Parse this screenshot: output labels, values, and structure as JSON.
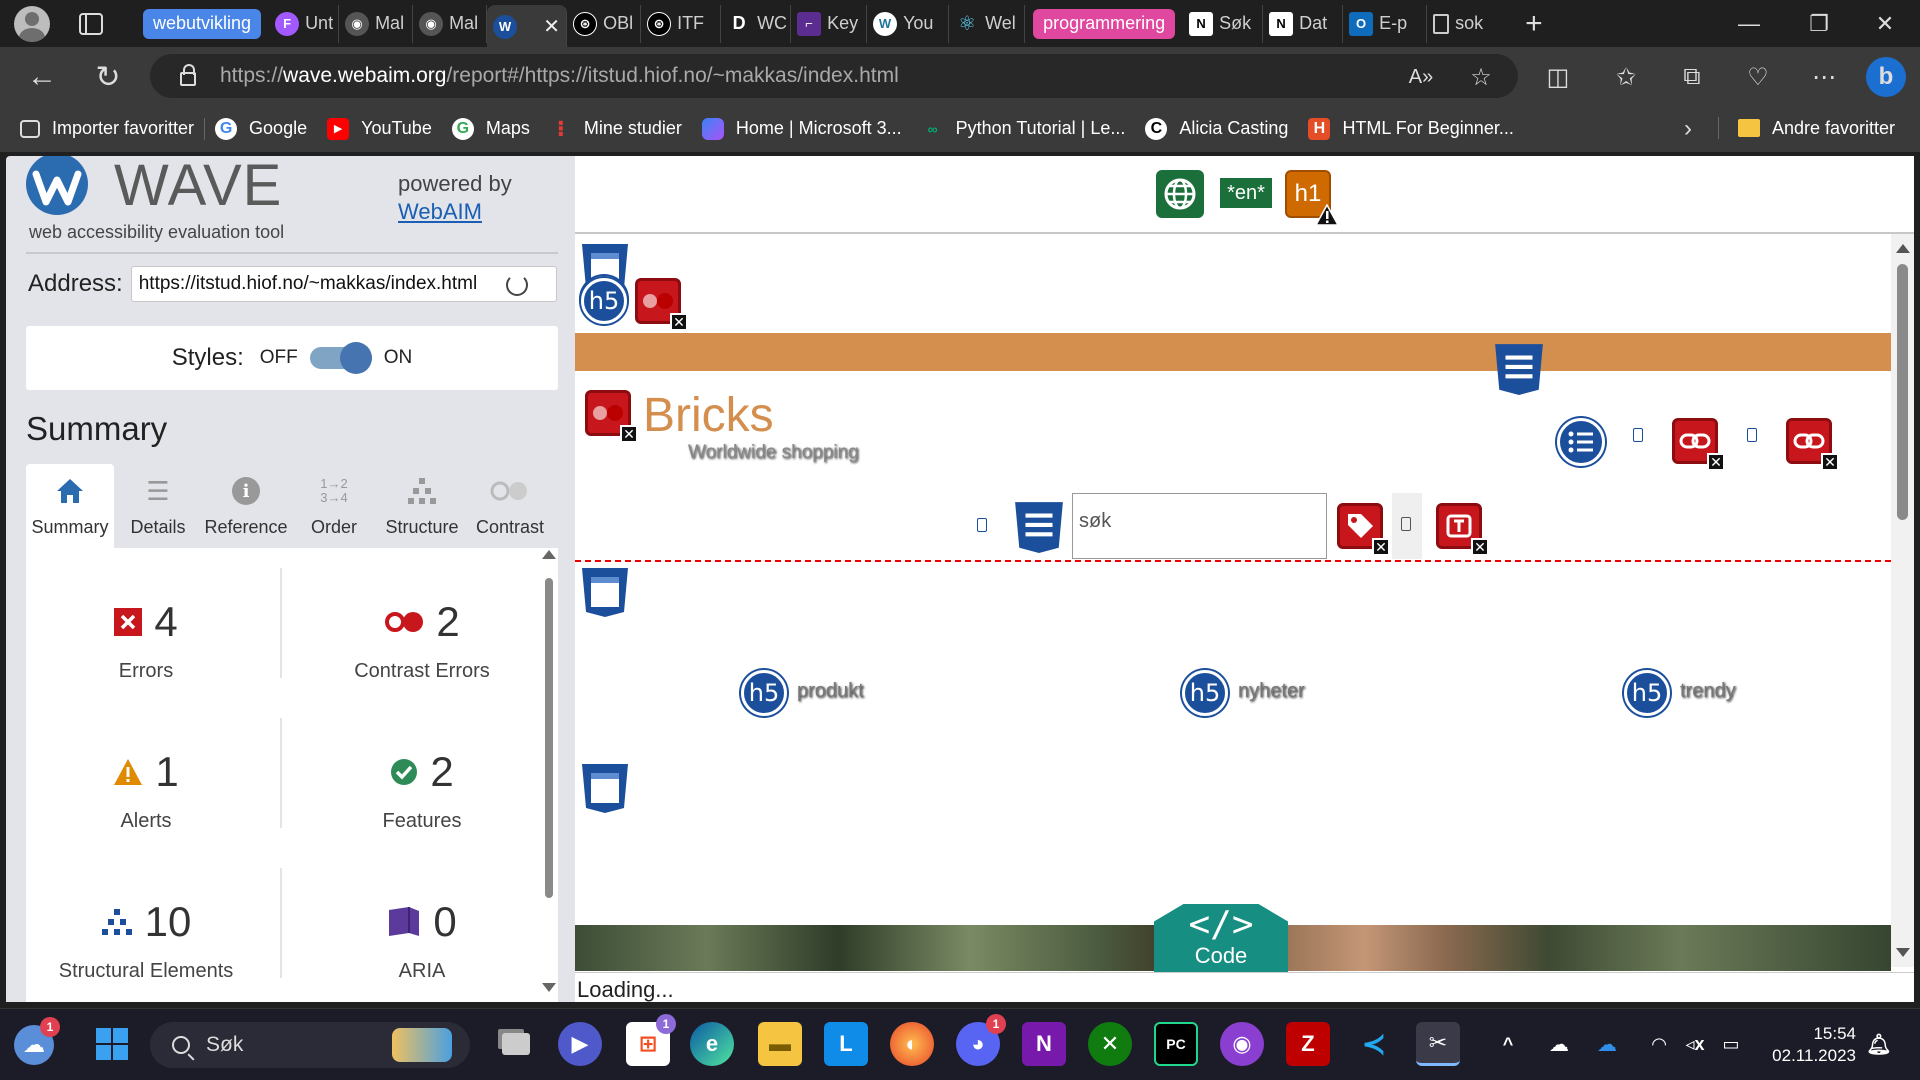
{
  "browser": {
    "tab_groups": [
      {
        "label": "webutvikling",
        "color": "#4a86e8"
      },
      {
        "label": "programmering",
        "color": "#e0479e"
      }
    ],
    "tabs": [
      {
        "label": "Unt",
        "icon": "figma-icon"
      },
      {
        "label": "Mal",
        "icon": "github-icon"
      },
      {
        "label": "Mal",
        "icon": "github-icon"
      },
      {
        "label": "",
        "icon": "wave-icon",
        "active": true
      },
      {
        "label": "OBl",
        "icon": "openai-icon"
      },
      {
        "label": "ITF",
        "icon": "openai-icon"
      },
      {
        "label": "WC",
        "icon": "d-icon"
      },
      {
        "label": "Key",
        "icon": "visual-studio-icon"
      },
      {
        "label": "You",
        "icon": "wordpress-icon"
      },
      {
        "label": "Wel",
        "icon": "react-icon"
      },
      {
        "label": "Søk",
        "icon": "notion-icon"
      },
      {
        "label": "Dat",
        "icon": "notion-icon"
      },
      {
        "label": "E-p",
        "icon": "outlook-icon"
      },
      {
        "label": "sok",
        "icon": "document-icon"
      }
    ],
    "url_host": "wave.webaim.org",
    "url_prefix": "https://",
    "url_path": "/report#/https://itstud.hiof.no/~makkas/index.html",
    "favorites": [
      {
        "label": "Importer favoritter",
        "icon": "import-icon"
      },
      {
        "label": "Google",
        "icon": "google-icon"
      },
      {
        "label": "YouTube",
        "icon": "youtube-icon"
      },
      {
        "label": "Maps",
        "icon": "google-maps-icon"
      },
      {
        "label": "Mine studier",
        "icon": "pin-icon"
      },
      {
        "label": "Home | Microsoft 3...",
        "icon": "microsoft365-icon"
      },
      {
        "label": "Python Tutorial | Le...",
        "icon": "python-icon"
      },
      {
        "label": "Alicia Casting",
        "icon": "c-icon"
      },
      {
        "label": "HTML For Beginner...",
        "icon": "html-icon"
      }
    ],
    "other_favorites": "Andre favoritter"
  },
  "wave": {
    "logo_text": "WAVE",
    "tagline": "web accessibility evaluation tool",
    "powered_by": "powered by",
    "powered_link": "WebAIM",
    "address_label": "Address:",
    "address_value": "https://itstud.hiof.no/~makkas/index.html",
    "styles_label": "Styles:",
    "styles_off": "OFF",
    "styles_on": "ON",
    "summary_title": "Summary",
    "tabs": [
      {
        "label": "Summary",
        "icon": "home-icon",
        "active": true
      },
      {
        "label": "Details",
        "icon": "list-icon"
      },
      {
        "label": "Reference",
        "icon": "info-icon"
      },
      {
        "label": "Order",
        "icon": "order-icon"
      },
      {
        "label": "Structure",
        "icon": "structure-icon"
      },
      {
        "label": "Contrast",
        "icon": "contrast-icon"
      }
    ],
    "stats": {
      "errors": {
        "count": "4",
        "label": "Errors",
        "color": "#c8161d"
      },
      "contrast": {
        "count": "2",
        "label": "Contrast Errors",
        "color": "#c8161d"
      },
      "alerts": {
        "count": "1",
        "label": "Alerts",
        "color": "#e08a00"
      },
      "features": {
        "count": "2",
        "label": "Features",
        "color": "#2e8b57"
      },
      "structural": {
        "count": "10",
        "label": "Structural Elements",
        "color": "#1b4f9c"
      },
      "aria": {
        "count": "0",
        "label": "ARIA",
        "color": "#5b3a9c"
      }
    }
  },
  "page": {
    "lang_badge": "*en*",
    "h1_badge": "h1",
    "h5_badge": "h5",
    "banner_text": "Worldwide shopping",
    "heading": "Bricks",
    "search_value": "søk",
    "nav_items": [
      "produkt",
      "nyheter",
      "trendy"
    ],
    "code_tag": "</>",
    "code_label": "Code",
    "status": "Loading..."
  },
  "taskbar": {
    "search_placeholder": "Søk",
    "time": "15:54",
    "date": "02.11.2023",
    "apps": [
      "windows-start-icon",
      "task-view-icon",
      "teams-icon",
      "microsoft-store-icon",
      "edge-icon",
      "file-explorer-icon",
      "l-app-icon",
      "firefox-icon",
      "discord-icon",
      "onenote-icon",
      "xbox-icon",
      "pycharm-icon",
      "github-desktop-icon",
      "filezilla-icon",
      "vscode-icon",
      "snipping-tool-icon"
    ]
  }
}
